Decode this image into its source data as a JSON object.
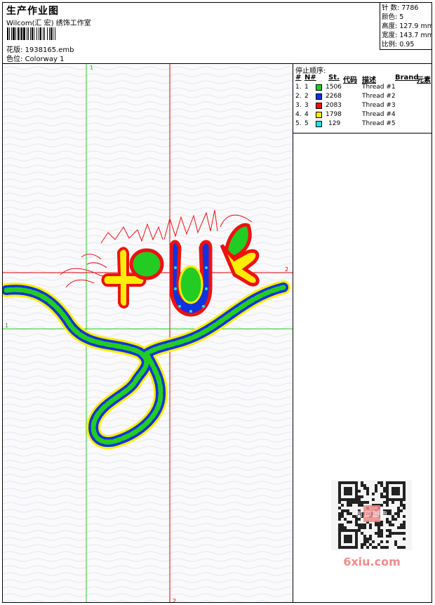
{
  "header": {
    "title": "生产作业图",
    "subtitle": "Wilcom(汇 宏) 绣饰工作室",
    "design_label": "花版:",
    "design_value": "1938165.emb",
    "colorway_label": "色位:",
    "colorway_value": "Colorway 1"
  },
  "stats": [
    {
      "label": "针 数:",
      "value": "7786"
    },
    {
      "label": "颜色:",
      "value": "5"
    },
    {
      "label": "高度:",
      "value": "127.9 mm"
    },
    {
      "label": "宽度:",
      "value": "143.7 mm"
    },
    {
      "label": "比例:",
      "value": "0.95"
    }
  ],
  "canvas": {
    "marker_1_top": "1",
    "marker_1_left": "1",
    "marker_2_right": "2",
    "marker_2_bottom": "2"
  },
  "stop_sequence": {
    "title": "停止顺序:",
    "headers": {
      "num": "#",
      "n": "N#",
      "st": "St.",
      "code": "代码",
      "desc": "描述",
      "brand": "Brand",
      "elem": "元素"
    },
    "rows": [
      {
        "idx": "1.",
        "n": "1",
        "color": "#22cc22",
        "stitches": "1506",
        "desc": "Thread #1"
      },
      {
        "idx": "2.",
        "n": "2",
        "color": "#1133dd",
        "stitches": "2268",
        "desc": "Thread #2"
      },
      {
        "idx": "3.",
        "n": "3",
        "color": "#ee1111",
        "stitches": "2083",
        "desc": "Thread #3"
      },
      {
        "idx": "4.",
        "n": "4",
        "color": "#ffee00",
        "stitches": "1798",
        "desc": "Thread #4"
      },
      {
        "idx": "5.",
        "n": "5",
        "color": "#22e0e8",
        "stitches": "129",
        "desc": "Thread #5"
      }
    ]
  },
  "watermark": {
    "text": "6xiu.com",
    "seal": "图 印 图 典"
  },
  "colors": {
    "guide_red": "#e00000",
    "guide_green": "#22cc22",
    "green": "#22cc22",
    "blue": "#1133dd",
    "red": "#ee1111",
    "yellow": "#ffee00",
    "cyan": "#22e0e8"
  }
}
